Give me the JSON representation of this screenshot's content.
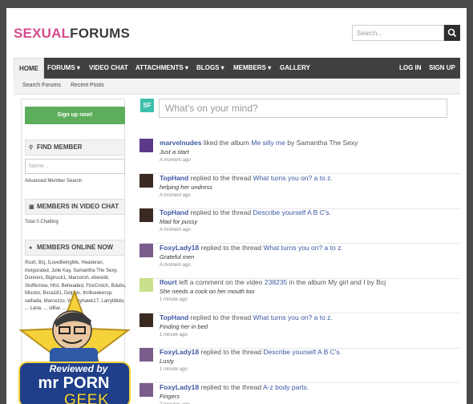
{
  "site": {
    "logo_part1": "SEXUAL",
    "logo_part2": "FORUMS",
    "search_placeholder": "Search..."
  },
  "nav": {
    "items": [
      "HOME",
      "FORUMS ▾",
      "VIDEO CHAT",
      "ATTACHMENTS ▾",
      "BLOGS ▾",
      "MEMBERS ▾",
      "GALLERY"
    ],
    "login": "LOG IN",
    "signup": "SIGN UP"
  },
  "subnav": {
    "search_forums": "Search Forums",
    "recent_posts": "Recent Posts"
  },
  "sidebar": {
    "signup_button": "Sign up now!",
    "find_member_title": "FIND MEMBER",
    "name_placeholder": "Name...",
    "advanced_search": "Advanced Member Search",
    "video_chat_title": "MEMBERS IN VIDEO CHAT",
    "video_chat_count": "Total 0 Chatting",
    "online_title": "MEMBERS ONLINE NOW",
    "online_names": "Ifourt, Bcj, ILoveBeingMe, Headeran, Invigorated, Julie Kay, Samantha The Sexy, Donners, Bigtruck1, Marcoroh, ebesidir, Stoffernow, Htst, Beheaded, FireCrotch, Bdubs, Misstor, Bxsa181, Delphic, thrillseekerup, valhalla, Marcezzo, W... nyhawk17, Larrylibido, ... Lana, ... stBar, ..."
  },
  "feed": {
    "avatar_initials": "SF",
    "post_placeholder": "What's on your mind?",
    "activities": [
      {
        "user": "marvelnudes",
        "verb": " liked the album ",
        "target": "Me silly me",
        "extra": " by Samantha The Sexy",
        "quote": "Just a start",
        "time": "A moment ago",
        "avatar_color": "#5b3a8a"
      },
      {
        "user": "TopHand",
        "verb": " replied to the thread ",
        "target": "What turns you on? a to z.",
        "extra": "",
        "quote": "helping her undress",
        "time": "A moment ago",
        "avatar_color": "#3a2a22"
      },
      {
        "user": "TopHand",
        "verb": " replied to the thread ",
        "target": "Describe yourself A B C's.",
        "extra": "",
        "quote": "Mad for pussy",
        "time": "A moment ago",
        "avatar_color": "#3a2a22"
      },
      {
        "user": "FoxyLady18",
        "verb": " replied to the thread ",
        "target": "What turns you on? a to z.",
        "extra": "",
        "quote": "Grateful men",
        "time": "A moment ago",
        "avatar_color": "#7a5c8c"
      },
      {
        "user": "Ifourt",
        "verb": " left a comment on the video ",
        "target": "238235",
        "extra": " in the album My girl and I by Bcj",
        "quote": "She needs a cock on her mouth too",
        "time": "1 minute ago",
        "avatar_color": "#c9e08a"
      },
      {
        "user": "TopHand",
        "verb": " replied to the thread ",
        "target": "What turns you on? a to z.",
        "extra": "",
        "quote": "Finding her in bed",
        "time": "1 minute ago",
        "avatar_color": "#3a2a22"
      },
      {
        "user": "FoxyLady18",
        "verb": " replied to the thread ",
        "target": "Describe yourself A B C's.",
        "extra": "",
        "quote": "Lusty",
        "time": "1 minute ago",
        "avatar_color": "#7a5c8c"
      },
      {
        "user": "FoxyLady18",
        "verb": " replied to the thread ",
        "target": "A-z body parts.",
        "extra": "",
        "quote": "Fingers",
        "time": "2 minutes ago",
        "avatar_color": "#7a5c8c"
      }
    ]
  },
  "badge": {
    "line1": "Reviewed by",
    "line2": "mr PORN",
    "line3": "GEEK"
  }
}
